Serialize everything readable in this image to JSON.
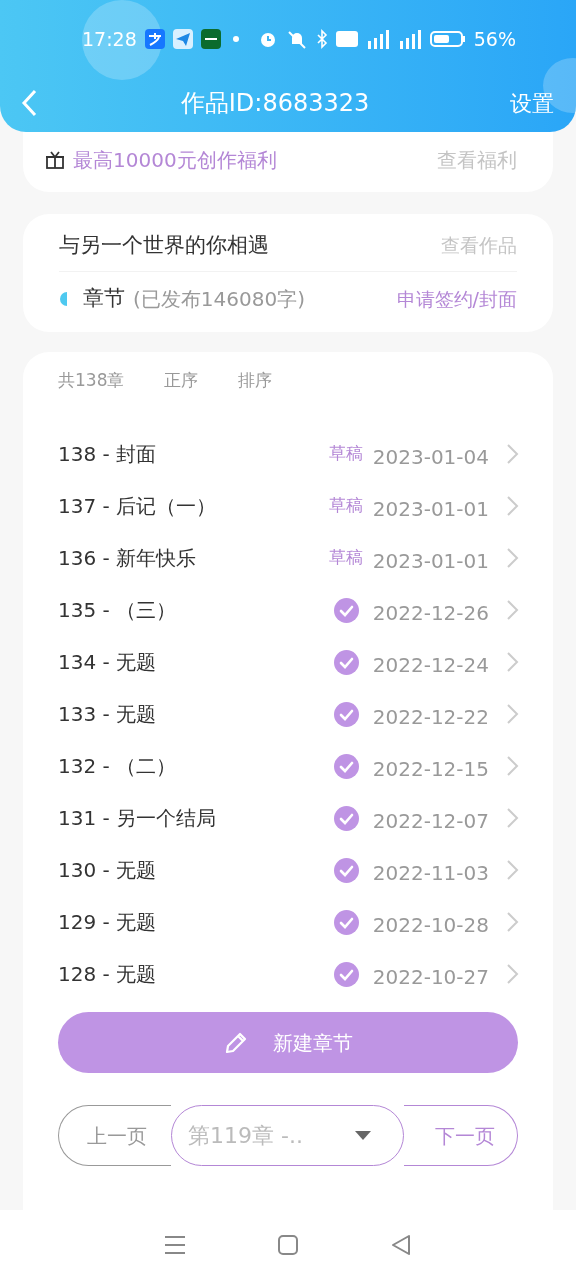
{
  "status_bar": {
    "time": "17:28",
    "battery": "56%"
  },
  "header": {
    "title": "作品ID:8683323",
    "action": "设置"
  },
  "benefit": {
    "text": "最高10000元创作福利",
    "link": "查看福利"
  },
  "work": {
    "title": "与另一个世界的你相遇",
    "link": "查看作品",
    "section_label": "章节",
    "section_info": "(已发布146080字)",
    "sign_link": "申请签约/封面"
  },
  "chapters": {
    "summary": "共138章",
    "order": "正序",
    "sort": "排序",
    "items": [
      {
        "title": "138 - 封面",
        "kind": "draft",
        "status": "草稿",
        "date": "2023-01-04"
      },
      {
        "title": "137 - 后记（一）",
        "kind": "draft",
        "status": "草稿",
        "date": "2023-01-01"
      },
      {
        "title": "136 - 新年快乐",
        "kind": "draft",
        "status": "草稿",
        "date": "2023-01-01"
      },
      {
        "title": "135 - （三）",
        "kind": "published",
        "date": "2022-12-26"
      },
      {
        "title": "134 - 无题",
        "kind": "published",
        "date": "2022-12-24"
      },
      {
        "title": "133 - 无题",
        "kind": "published",
        "date": "2022-12-22"
      },
      {
        "title": "132 - （二）",
        "kind": "published",
        "date": "2022-12-15"
      },
      {
        "title": "131 - 另一个结局",
        "kind": "published",
        "date": "2022-12-07"
      },
      {
        "title": "130 - 无题",
        "kind": "published",
        "date": "2022-11-03"
      },
      {
        "title": "129 - 无题",
        "kind": "published",
        "date": "2022-10-28"
      },
      {
        "title": "128 - 无题",
        "kind": "published",
        "date": "2022-10-27"
      }
    ]
  },
  "new_button": "新建章节",
  "pager": {
    "prev": "上一页",
    "select_value": "第119章 -..",
    "next": "下一页"
  }
}
